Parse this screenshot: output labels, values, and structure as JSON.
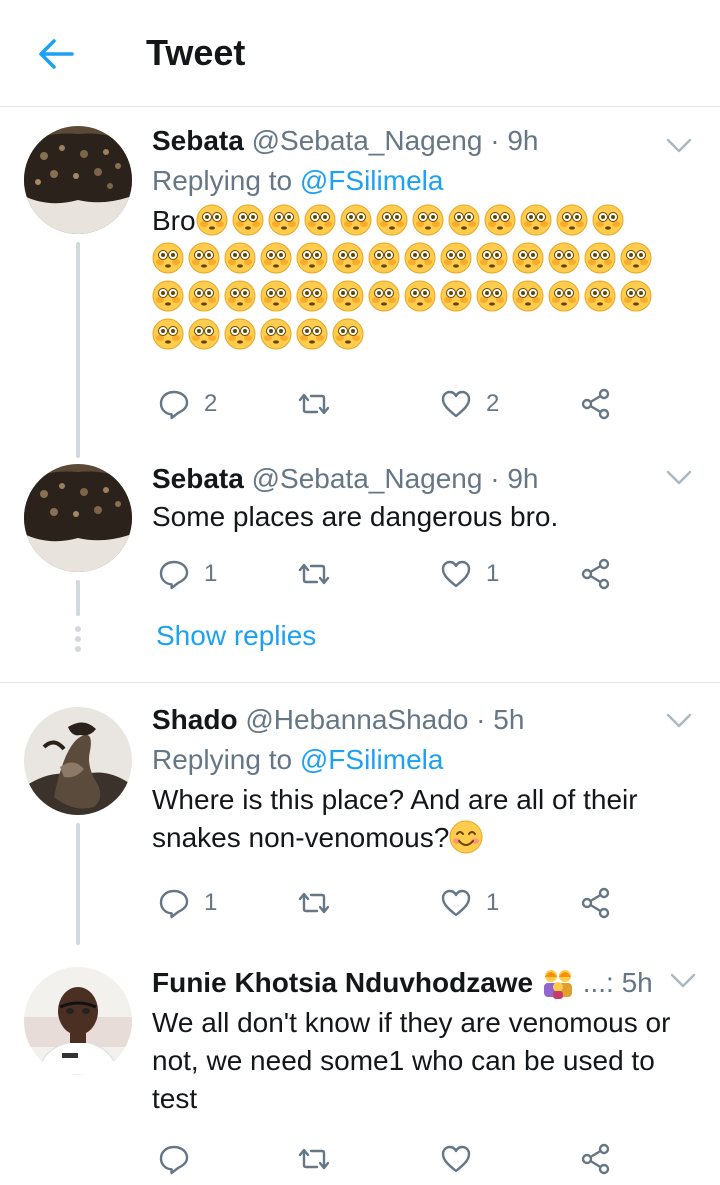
{
  "header": {
    "title": "Tweet"
  },
  "colors": {
    "accent": "#1da1f2",
    "muted": "#657786",
    "text": "#14171a",
    "line": "#cfd9de"
  },
  "tweets": [
    {
      "name": "Sebata",
      "handle": "@Sebata_Nageng",
      "time": "· 9h",
      "replying_label": "Replying to",
      "replying_to": "@FSilimela",
      "text": "Bro",
      "emoji": "flushed-face",
      "emoji_rows": [
        12,
        14,
        14,
        6
      ],
      "reply_count": "2",
      "retweet_count": "",
      "like_count": "2"
    },
    {
      "name": "Sebata",
      "handle": "@Sebata_Nageng",
      "time": "· 9h",
      "text": "Some places are dangerous bro.",
      "reply_count": "1",
      "retweet_count": "",
      "like_count": "1"
    },
    {
      "name": "Shado",
      "handle": "@HebannaShado",
      "time": "· 5h",
      "replying_label": "Replying to",
      "replying_to": "@FSilimela",
      "text_line1": "Where is this place? And are all of their",
      "text_line2": "snakes non-venomous?",
      "emoji": "smiling-face-with-smiling-eyes",
      "reply_count": "1",
      "retweet_count": "",
      "like_count": "1"
    },
    {
      "name": "Funie Khotsia Nduvhodzawe",
      "handle": "...:",
      "time": "5h",
      "name_emoji": "family-emoji",
      "text": "We all don't know if they are venomous or not, we need some1 who can be used to test",
      "reply_count": "",
      "retweet_count": "",
      "like_count": ""
    }
  ],
  "show_replies": "Show replies"
}
